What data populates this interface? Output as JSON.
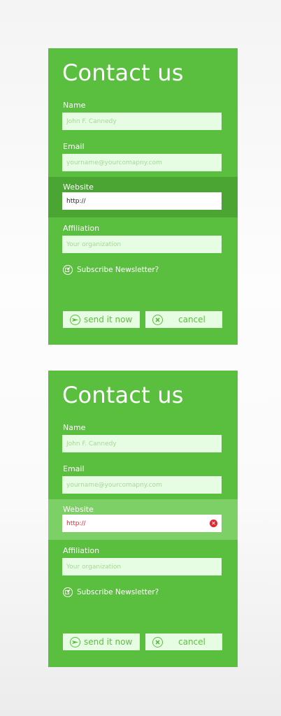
{
  "colors": {
    "card_bg": "#5abf3e",
    "input_bg": "#e7fde3",
    "active_dark": "#4aa532",
    "active_light": "#7cd065",
    "error": "#e0262e",
    "button_text": "#5abf3e"
  },
  "cards": [
    {
      "title": "Contact us",
      "fields": {
        "name": {
          "label": "Name",
          "placeholder": "John F. Cannedy"
        },
        "email": {
          "label": "Email",
          "placeholder": "yourname@yourcomapny.com"
        },
        "website": {
          "label": "Website",
          "value": "http://"
        },
        "affiliation": {
          "label": "Affiliation",
          "placeholder": "Your organization"
        }
      },
      "subscribe": {
        "label": "Subscribe Newsletter?",
        "icon": "newsletter-check-icon"
      },
      "buttons": {
        "send": {
          "label": "send it now",
          "icon": "send-icon"
        },
        "cancel": {
          "label": "cancel",
          "icon": "cancel-icon"
        }
      }
    },
    {
      "title": "Contact us",
      "fields": {
        "name": {
          "label": "Name",
          "placeholder": "John F. Cannedy"
        },
        "email": {
          "label": "Email",
          "placeholder": "yourname@yourcomapny.com"
        },
        "website": {
          "label": "Website",
          "value": "http://",
          "error_icon": "error-icon"
        },
        "affiliation": {
          "label": "Affiliation",
          "placeholder": "Your organization"
        }
      },
      "subscribe": {
        "label": "Subscribe Newsletter?",
        "icon": "newsletter-check-icon"
      },
      "buttons": {
        "send": {
          "label": "send it now",
          "icon": "send-icon"
        },
        "cancel": {
          "label": "cancel",
          "icon": "cancel-icon"
        }
      }
    }
  ]
}
